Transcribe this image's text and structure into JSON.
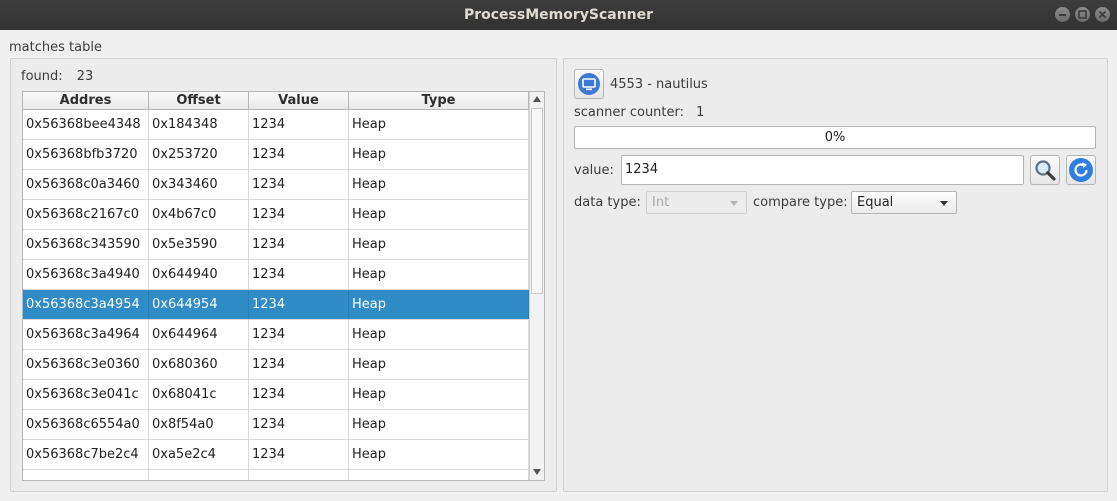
{
  "window": {
    "title": "ProcessMemoryScanner"
  },
  "matches": {
    "group_title": "matches table",
    "found_label": "found:",
    "found_count": "23",
    "columns": [
      "Addres",
      "Offset",
      "Value",
      "Type"
    ],
    "rows": [
      [
        "0x56368bee4348",
        "0x184348",
        "1234",
        "Heap"
      ],
      [
        "0x56368bfb3720",
        "0x253720",
        "1234",
        "Heap"
      ],
      [
        "0x56368c0a3460",
        "0x343460",
        "1234",
        "Heap"
      ],
      [
        "0x56368c2167c0",
        "0x4b67c0",
        "1234",
        "Heap"
      ],
      [
        "0x56368c343590",
        "0x5e3590",
        "1234",
        "Heap"
      ],
      [
        "0x56368c3a4940",
        "0x644940",
        "1234",
        "Heap"
      ],
      [
        "0x56368c3a4954",
        "0x644954",
        "1234",
        "Heap"
      ],
      [
        "0x56368c3a4964",
        "0x644964",
        "1234",
        "Heap"
      ],
      [
        "0x56368c3e0360",
        "0x680360",
        "1234",
        "Heap"
      ],
      [
        "0x56368c3e041c",
        "0x68041c",
        "1234",
        "Heap"
      ],
      [
        "0x56368c6554a0",
        "0x8f54a0",
        "1234",
        "Heap"
      ],
      [
        "0x56368c7be2c4",
        "0xa5e2c4",
        "1234",
        "Heap"
      ],
      [
        "",
        "",
        "",
        ""
      ]
    ],
    "selected_row": 6,
    "selection_color": "#308cc6"
  },
  "scanner": {
    "process_label": "4553 - nautilus",
    "counter_label": "scanner counter:",
    "counter_value": "1",
    "progress_text": "0%",
    "progress_fraction": 0,
    "value_label": "value:",
    "value_input": "1234",
    "data_type_label": "data type:",
    "data_type_value": "Int",
    "compare_type_label": "compare type:",
    "compare_type_value": "Equal",
    "icons": {
      "process": "monitor-icon",
      "search": "magnifier-icon",
      "refresh": "refresh-icon"
    },
    "accent_color": "#2f7fe0"
  }
}
